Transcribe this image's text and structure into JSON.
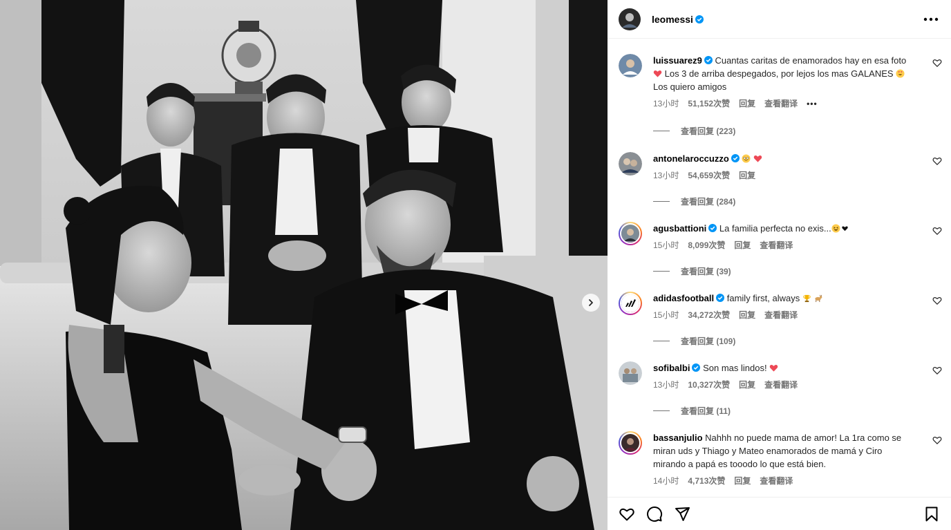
{
  "post": {
    "username": "leomessi",
    "photo_alt": ""
  },
  "comments": [
    {
      "username": "luissuarez9",
      "text": "Cuantas caritas de enamorados hay en esa foto",
      "line2": " Los 3 de arriba despegados, por lejos los mas GALANES ",
      "line3": "Los quiero amigos",
      "time": "13小时",
      "likes": "51,152次赞",
      "reply": "回复",
      "translate": "查看翻译",
      "more": "•••",
      "view_replies": "查看回复 (223)"
    },
    {
      "username": "antonelaroccuzzo",
      "text": "",
      "time": "13小时",
      "likes": "54,659次赞",
      "reply": "回复",
      "view_replies": "查看回复 (284)"
    },
    {
      "username": "agusbattioni",
      "text": "La familia perfecta no exis...",
      "time": "15小时",
      "likes": "8,099次赞",
      "reply": "回复",
      "translate": "查看翻译",
      "view_replies": "查看回复 (39)"
    },
    {
      "username": "adidasfootball",
      "text": "family first, always",
      "time": "15小时",
      "likes": "34,272次赞",
      "reply": "回复",
      "translate": "查看翻译",
      "view_replies": "查看回复 (109)"
    },
    {
      "username": "sofibalbi",
      "text": "Son mas lindos!",
      "time": "13小时",
      "likes": "10,327次赞",
      "reply": "回复",
      "translate": "查看翻译",
      "view_replies": "查看回复 (11)"
    },
    {
      "username": "bassanjulio",
      "text": "Nahhh no puede mama de amor! La 1ra como se",
      "line2": "miran uds y Thiago y Mateo enamorados de mamá y Ciro",
      "line3": "mirando a papá es tooodo lo que está bien.",
      "time": "14小时",
      "likes": "4,713次赞",
      "reply": "回复",
      "translate": "查看翻译"
    }
  ],
  "icons": {
    "more": "more-horizontal-icon",
    "like": "heart-icon",
    "comment": "comment-icon",
    "share": "send-icon",
    "save": "bookmark-icon",
    "next": "chevron-right-icon"
  },
  "colors": {
    "verified": "#0095f6",
    "heart_red": "#ed4956",
    "meta_gray": "#737373"
  }
}
